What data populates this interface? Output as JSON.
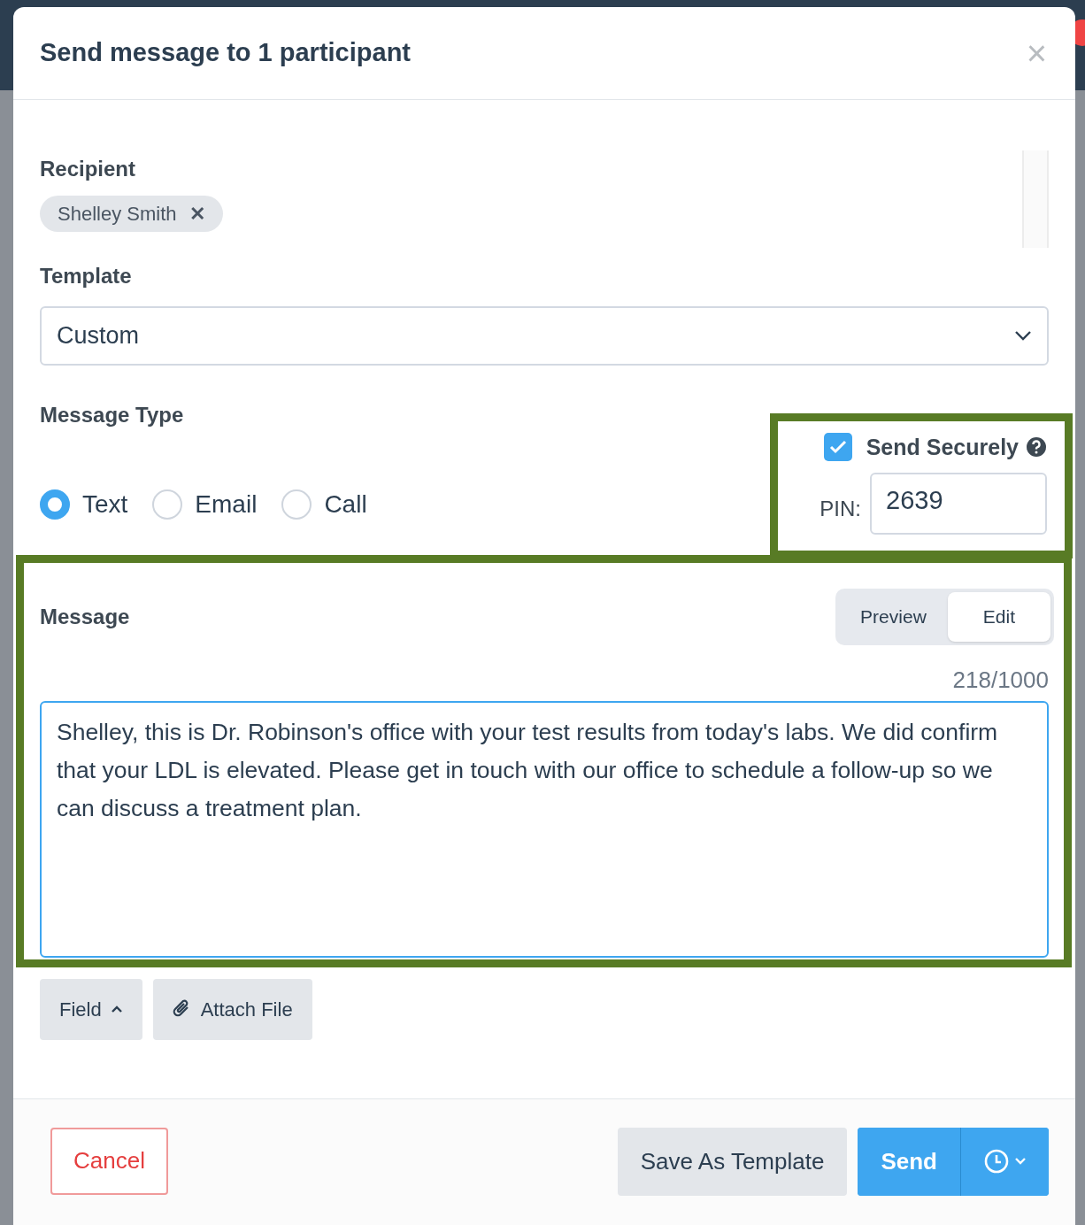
{
  "dialog": {
    "title": "Send message to 1 participant",
    "close": "×"
  },
  "recipient": {
    "label": "Recipient",
    "chips": [
      {
        "name": "Shelley Smith",
        "remove": "✕"
      }
    ]
  },
  "template": {
    "label": "Template",
    "value": "Custom"
  },
  "message_type": {
    "label": "Message Type",
    "options": [
      {
        "label": "Text",
        "selected": true
      },
      {
        "label": "Email",
        "selected": false
      },
      {
        "label": "Call",
        "selected": false
      }
    ]
  },
  "send_securely": {
    "label": "Send Securely",
    "checked": true,
    "pin_label": "PIN:",
    "pin": "2639"
  },
  "message": {
    "label": "Message",
    "modes": [
      {
        "label": "Preview",
        "selected": false
      },
      {
        "label": "Edit",
        "selected": true
      }
    ],
    "counter": "218/1000",
    "text": "Shelley, this is Dr. Robinson's office with your test results from today's labs. We did confirm that your LDL is elevated. Please get in touch with our office to schedule a follow-up so we can discuss a treatment plan."
  },
  "tools": [
    {
      "label": "Field",
      "kind": "caret"
    },
    {
      "label": "Attach File",
      "kind": "paperclip"
    }
  ],
  "footer": {
    "cancel": "Cancel",
    "save": "Save As Template",
    "send": "Send"
  }
}
